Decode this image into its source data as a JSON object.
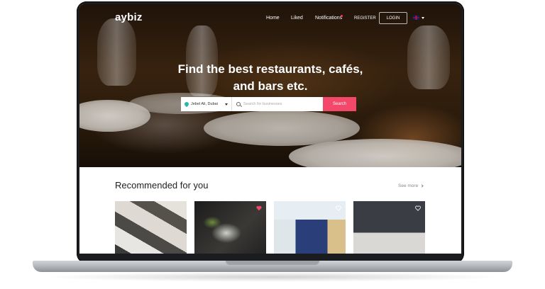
{
  "brand": {
    "logo": "aybiz",
    "accent": "#f4486a"
  },
  "nav": {
    "home": "Home",
    "liked": "Liked",
    "notifications": "Notifications",
    "register": "REGISTER",
    "login": "LOGIN",
    "language_icon": "uk-flag-icon"
  },
  "hero": {
    "headline_line1": "Find the best restaurants, cafés,",
    "headline_line2": "and bars etc."
  },
  "search": {
    "location": "Jebel Ali, Dubai",
    "placeholder": "Search for businesses",
    "button": "Search"
  },
  "recommended": {
    "title": "Recommended for you",
    "see_more": "See more",
    "cards": [
      {
        "liked": false
      },
      {
        "liked": true,
        "like_color": "#f4486a"
      },
      {
        "liked": false
      },
      {
        "liked": false
      }
    ]
  }
}
